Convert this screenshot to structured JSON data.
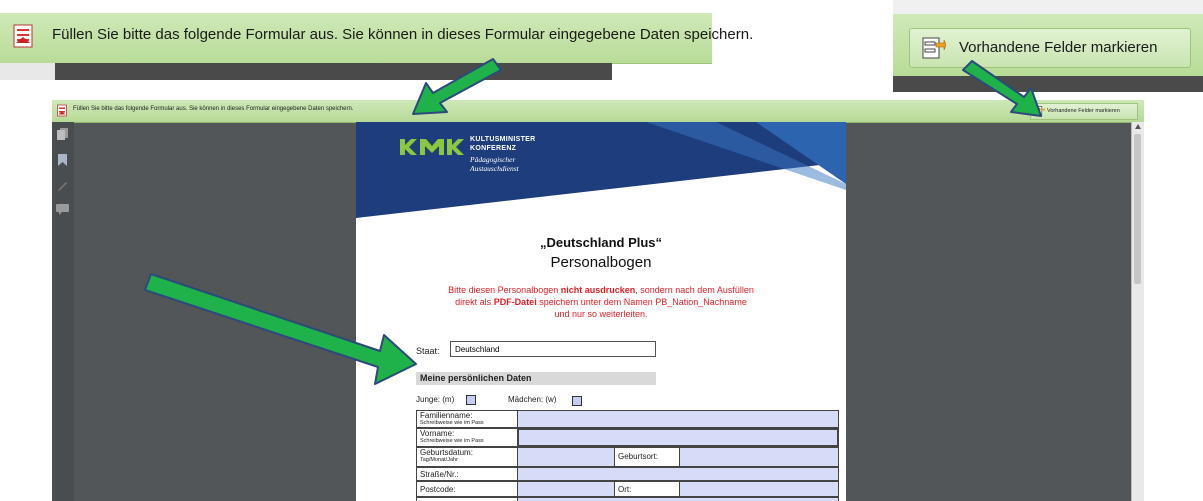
{
  "zoom_left": {
    "message": "Füllen Sie bitte das folgende Formular aus. Sie können in dieses Formular eingegebene Daten speichern."
  },
  "zoom_right": {
    "button_label": "Vorhandene Felder markieren"
  },
  "reader": {
    "message": "Füllen Sie bitte das folgende Formular aus. Sie können in dieses Formular eingegebene Daten speichern.",
    "highlight_button_label": "Vorhandene Felder markieren"
  },
  "document": {
    "logo": {
      "mark": "KMK",
      "line1": "KULTUSMINISTER",
      "line2": "KONFERENZ",
      "line3": "Pädagogischer",
      "line4": "Austauschdienst"
    },
    "title": "„Deutschland Plus“",
    "subtitle": "Personalbogen",
    "instruction": {
      "line1_a": "Bitte diesen Personalbogen ",
      "line1_b": "nicht ausdrucken",
      "line1_c": ", sondern nach dem Ausfüllen",
      "line2_a": "direkt als ",
      "line2_b": "PDF-Datei",
      "line2_c": " speichern unter dem Namen PB_Nation_Nachname",
      "line3": "und nur so weiterleiten."
    },
    "staat_label": "Staat:",
    "staat_value": "Deutschland",
    "section_heading": "Meine persönlichen Daten",
    "junge_label": "Junge:  (m)",
    "maedchen_label": "Mädchen:  (w)",
    "rows": {
      "familienname": "Familienname:",
      "familienname_hint": "Schreibweise wie im Pass",
      "vorname": "Vorname:",
      "vorname_hint": "Schreibweise wie im Pass",
      "geburtsdatum": "Geburtsdatum:",
      "geburtsdatum_hint": "Tag/Monat/Jahr",
      "geburtsort": "Geburtsort:",
      "strasse": "Straße/Nr.:",
      "postcode": "Postcode:",
      "ort": "Ort:"
    }
  },
  "colors": {
    "bar_green": "#c3e2a6",
    "arrow_green": "#1fb24a",
    "arrow_outline": "#2c4a7a",
    "header_blue": "#1d3d7c",
    "field_blue": "#d6dcf7",
    "red_text": "#e31e24"
  }
}
